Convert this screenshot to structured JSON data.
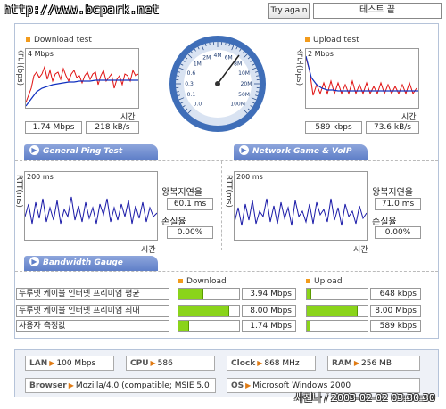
{
  "site_url": "http://www.bcpark.net",
  "try_again_label": "Try again",
  "status_text": "테스트 끝",
  "download": {
    "title": "Download test",
    "y_axis": "속도(bps)",
    "y_max": "4 Mbps",
    "time_label": "시간",
    "speed": "1.74 Mbps",
    "rate": "218 kB/s"
  },
  "upload": {
    "title": "Upload test",
    "y_axis": "속도(bps)",
    "y_max": "2 Mbps",
    "time_label": "시간",
    "speed": "589 kbps",
    "rate": "73.6 kB/s"
  },
  "gauge": {
    "ticks": [
      "0.0",
      "0.1",
      "0.3",
      "0.6",
      "1M",
      "2M",
      "4M",
      "6M",
      "8M",
      "10M",
      "20M",
      "50M",
      "100M"
    ],
    "needle_value": "1.74 Mbps"
  },
  "tabs": {
    "general_ping": "General Ping Test",
    "network_game": "Network Game & VoIP Test",
    "bandwidth": "Bandwidth Gauge"
  },
  "ping_general": {
    "y_axis": "RTT(ms)",
    "y_max": "200 ms",
    "time_label": "시간",
    "rtt_label": "왕복지연율",
    "rtt_value": "60.1 ms",
    "loss_label": "손실율",
    "loss_value": "0.00%"
  },
  "ping_game": {
    "y_axis": "RTT(ms)",
    "y_max": "200 ms",
    "time_label": "시간",
    "rtt_label": "왕복지연율",
    "rtt_value": "71.0 ms",
    "loss_label": "손실율",
    "loss_value": "0.00%"
  },
  "bandwidth": {
    "download_header": "Download",
    "upload_header": "Upload",
    "rows": [
      {
        "label": "두루넷 케이블 인터넷 프리미엄 평균",
        "download": "3.94 Mbps",
        "download_fraction": 0.41,
        "upload": "648 kbps",
        "upload_fraction": 0.07
      },
      {
        "label": "두루넷 케이블 인터넷 프리미엄 최대",
        "download": "8.00 Mbps",
        "download_fraction": 0.84,
        "upload": "8.00 Mbps",
        "upload_fraction": 0.84
      },
      {
        "label": "사용자 측정값",
        "download": "1.74 Mbps",
        "download_fraction": 0.18,
        "upload": "589 kbps",
        "upload_fraction": 0.06
      }
    ]
  },
  "system": {
    "lan_label": "LAN",
    "lan_value": "100 Mbps",
    "cpu_label": "CPU",
    "cpu_value": "586",
    "clock_label": "Clock",
    "clock_value": "868 MHz",
    "ram_label": "RAM",
    "ram_value": "256 MB",
    "browser_label": "Browser",
    "browser_value": "Mozilla/4.0 (compatible; MSIE 5.0",
    "os_label": "OS",
    "os_value": "Microsoft Windows 2000"
  },
  "watermark": "사진나 / 2003-02-02 03:30:30",
  "colors": {
    "download_line": "#e01010",
    "download_avg": "#1030c0",
    "ping_line": "#1a1aa8",
    "bar_fill": "#8ad41a",
    "gauge_ring": "#3f6eb8"
  }
}
